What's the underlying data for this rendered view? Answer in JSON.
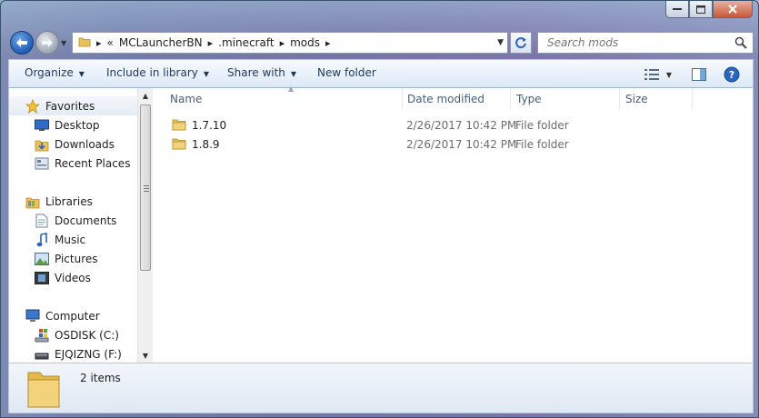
{
  "breadcrumb": {
    "overflow": "«",
    "segments": [
      "MCLauncherBN",
      ".minecraft",
      "mods"
    ]
  },
  "search": {
    "placeholder": "Search mods"
  },
  "toolbar": {
    "organize": "Organize",
    "include_in_library": "Include in library",
    "share_with": "Share with",
    "new_folder": "New folder"
  },
  "sidebar": {
    "favorites": "Favorites",
    "desktop": "Desktop",
    "downloads": "Downloads",
    "recent_places": "Recent Places",
    "libraries": "Libraries",
    "documents": "Documents",
    "music": "Music",
    "pictures": "Pictures",
    "videos": "Videos",
    "computer": "Computer",
    "osdisk": "OSDISK (C:)",
    "ejqizng": "EJQIZNG (F:)"
  },
  "columns": {
    "name": "Name",
    "date_modified": "Date modified",
    "type": "Type",
    "size": "Size"
  },
  "files": [
    {
      "name": "1.7.10",
      "date": "2/26/2017 10:42 PM",
      "type": "File folder"
    },
    {
      "name": "1.8.9",
      "date": "2/26/2017 10:42 PM",
      "type": "File folder"
    }
  ],
  "details": {
    "count": "2 items"
  },
  "colors": {
    "accent": "#1e395b",
    "folder": "#e8c15a",
    "selection": "#e6ecf5"
  }
}
